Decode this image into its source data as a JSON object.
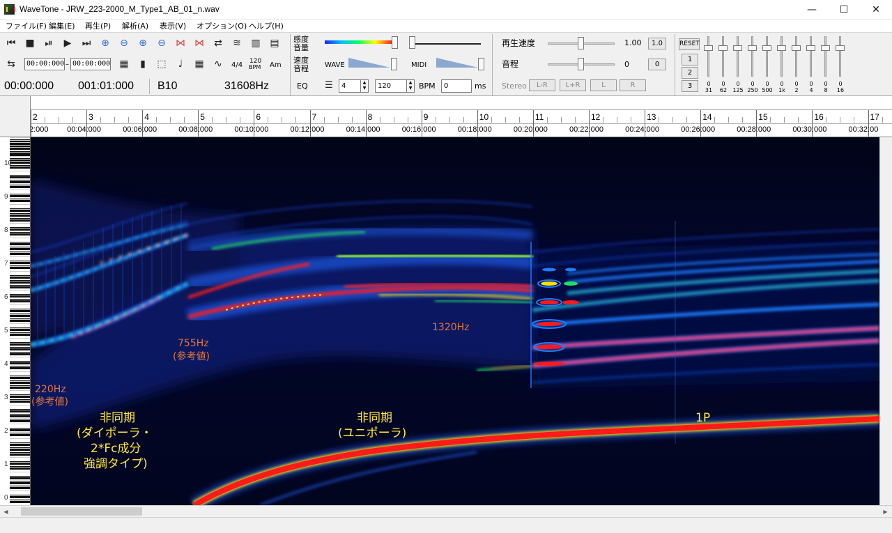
{
  "window": {
    "title": "WaveTone - JRW_223-2000_M_Type1_AB_01_n.wav",
    "minimize": "—",
    "maximize": "☐",
    "close": "✕"
  },
  "menu": [
    "ファイル(F)",
    "編集(E)",
    "再生(P)",
    "解析(A)",
    "表示(V)",
    "オプション(O)",
    "ヘルプ(H)"
  ],
  "toolbar": {
    "range_start": "00:00:000",
    "range_end": "00:00:000",
    "time_sig": "4/4",
    "bpm_icon_top": "120",
    "bpm_icon_bottom": "BPM",
    "am_icon": "Am",
    "position_time": "00:00:000",
    "position_measure": "001:01:000",
    "note": "B10",
    "frequency": "31608Hz",
    "sens_label_1": "感度",
    "sens_label_2": "音量",
    "speed_label_1": "速度",
    "speed_label_2": "音程",
    "eq_label": "EQ",
    "wave_label": "WAVE",
    "midi_label": "MIDI",
    "beats_value": "4",
    "bpm_value": "120",
    "bpm_label": "BPM",
    "offset_value": "0",
    "offset_unit": "ms",
    "playback_speed_label": "再生速度",
    "playback_speed_value": "1.00",
    "playback_speed_reset": "1.0",
    "pitch_label": "音程",
    "pitch_value": "0",
    "pitch_reset": "0",
    "stereo_label": "Stereo",
    "lr_minus": "L-R",
    "lr_plus": "L+R",
    "l_btn": "L",
    "r_btn": "R",
    "reset_btn": "RESET",
    "preset_1": "1",
    "preset_2": "2",
    "preset_3": "3",
    "eq_bands": [
      {
        "value": "0",
        "freq": "31"
      },
      {
        "value": "0",
        "freq": "62"
      },
      {
        "value": "0",
        "freq": "125"
      },
      {
        "value": "0",
        "freq": "250"
      },
      {
        "value": "0",
        "freq": "500"
      },
      {
        "value": "0",
        "freq": "1k"
      },
      {
        "value": "0",
        "freq": "2"
      },
      {
        "value": "0",
        "freq": "4"
      },
      {
        "value": "0",
        "freq": "8"
      },
      {
        "value": "0",
        "freq": "16"
      }
    ]
  },
  "ruler": {
    "measures": [
      "2",
      "3",
      "4",
      "5",
      "6",
      "7",
      "8",
      "9",
      "10",
      "11",
      "12",
      "13",
      "14",
      "15",
      "16",
      "17"
    ],
    "times": [
      "2:000",
      "00:04:000",
      "00:06:000",
      "00:08:000",
      "00:10:000",
      "00:12:000",
      "00:14:000",
      "00:16:000",
      "00:18:000",
      "00:20:000",
      "00:22:000",
      "00:24:000",
      "00:26:000",
      "00:28:000",
      "00:30:000",
      "00:32:00"
    ]
  },
  "keyboard": {
    "octaves": [
      "10",
      "9",
      "8",
      "7",
      "6",
      "5",
      "4",
      "3",
      "2",
      "1",
      "0"
    ]
  },
  "annotations": {
    "hz_220": "220Hz",
    "ref_220": "(参考値)",
    "hz_755": "755Hz",
    "ref_755": "(参考値)",
    "hz_1320": "1320Hz",
    "async_dipolar_1": "非同期",
    "async_dipolar_2": "(ダイポーラ・",
    "async_dipolar_3": "2*Fc成分",
    "async_dipolar_4": "強調タイプ)",
    "async_unipolar_1": "非同期",
    "async_unipolar_2": "(ユニポーラ)",
    "one_pulse": "1P"
  },
  "colors": {
    "spectrogram_bg": "#020418",
    "annotation_yellow": "#ffe83a",
    "annotation_orange": "#e07838",
    "hot": "#ff1a1a",
    "warm": "#ffe000",
    "mid": "#20e060",
    "cool": "#1f7cff"
  }
}
